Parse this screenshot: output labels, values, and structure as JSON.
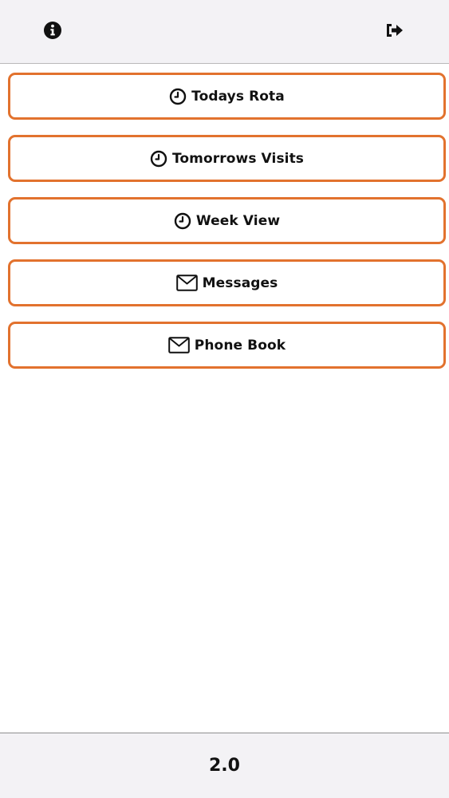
{
  "header": {
    "info_icon": "info-circle-icon",
    "logout_icon": "sign-out-icon"
  },
  "menu": {
    "items": [
      {
        "label": "Todays Rota",
        "icon": "clock-icon"
      },
      {
        "label": "Tomorrows Visits",
        "icon": "clock-icon"
      },
      {
        "label": "Week View",
        "icon": "clock-icon"
      },
      {
        "label": "Messages",
        "icon": "envelope-icon"
      },
      {
        "label": "Phone Book",
        "icon": "envelope-icon"
      }
    ]
  },
  "footer": {
    "version": "2.0"
  },
  "colors": {
    "accent_border": "#e2722e",
    "bar_background": "#f3f2f5",
    "text": "#111111"
  }
}
